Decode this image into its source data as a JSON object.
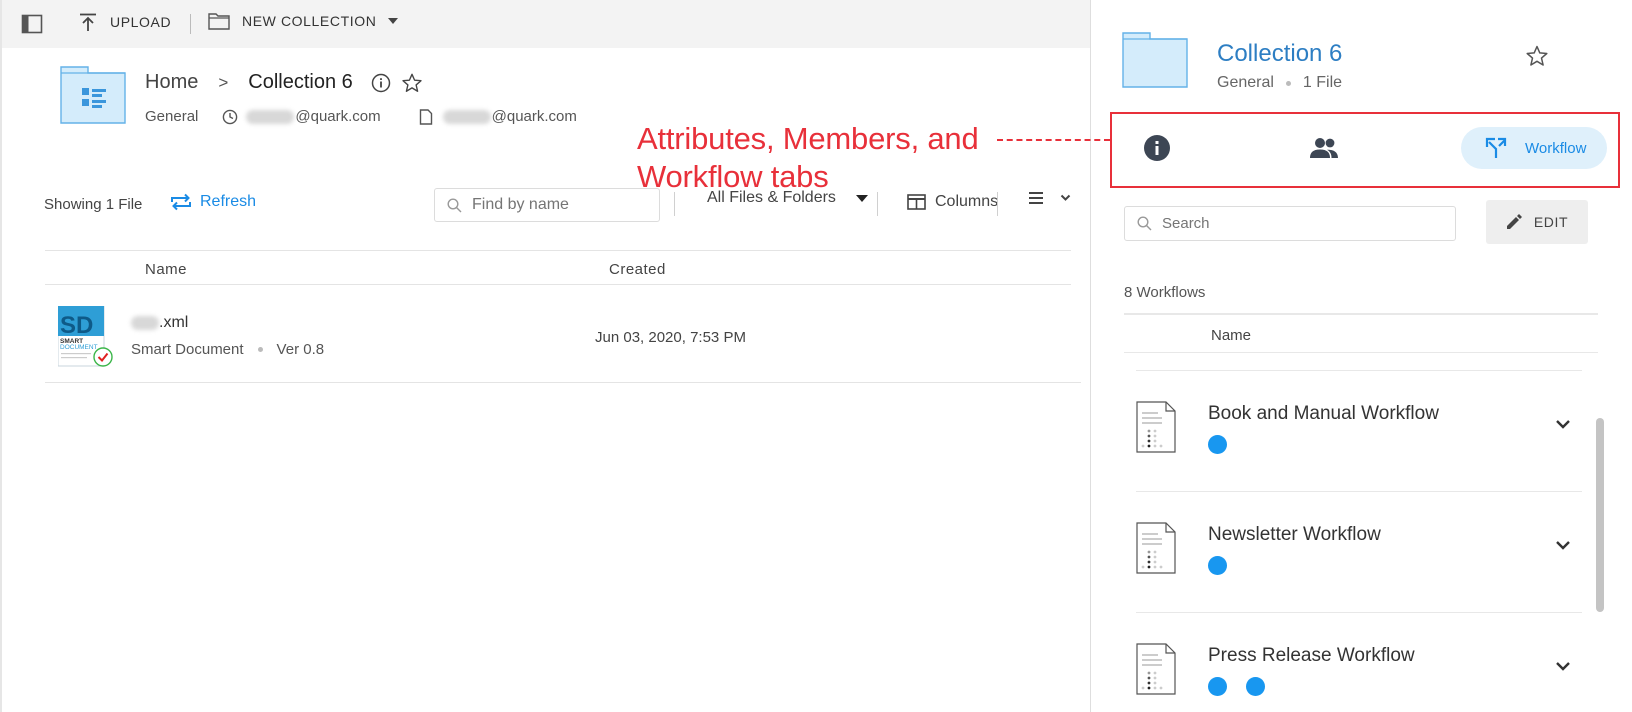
{
  "toolbar": {
    "upload_label": "UPLOAD",
    "new_collection_label": "NEW COLLECTION"
  },
  "breadcrumb": {
    "home": "Home",
    "separator": ">",
    "current": "Collection 6"
  },
  "meta": {
    "category": "General",
    "created_by_domain": "@quark.com",
    "modified_by_domain": "@quark.com"
  },
  "annotation": {
    "line1": "Attributes, Members, and",
    "line2": "Workflow tabs"
  },
  "list": {
    "showing": "Showing 1 File",
    "refresh": "Refresh",
    "search_placeholder": "Find by name",
    "filter": "All Files & Folders",
    "columns": "Columns"
  },
  "table": {
    "headers": [
      "Name",
      "Created"
    ],
    "rows": [
      {
        "name_suffix": ".xml",
        "type": "Smart Document",
        "version": "Ver 0.8",
        "created": "Jun 03, 2020, 7:53 PM",
        "thumb_text": "SD",
        "thumb_line1": "SMART",
        "thumb_line2": "DOCUMENT"
      }
    ]
  },
  "panel": {
    "title": "Collection 6",
    "category": "General",
    "files": "1 File",
    "tabs": {
      "workflow": "Workflow"
    },
    "search_placeholder": "Search",
    "edit": "EDIT",
    "count": "8 Workflows",
    "name_header": "Name",
    "workflows": [
      {
        "name": "Book and Manual Workflow",
        "dots": 1
      },
      {
        "name": "Newsletter Workflow",
        "dots": 1
      },
      {
        "name": "Press Release Workflow",
        "dots": 2
      }
    ]
  },
  "colors": {
    "accent": "#1a8be5",
    "annotation": "#e8303a",
    "status_dot": "#1897f0",
    "title": "#2d7ec3"
  }
}
